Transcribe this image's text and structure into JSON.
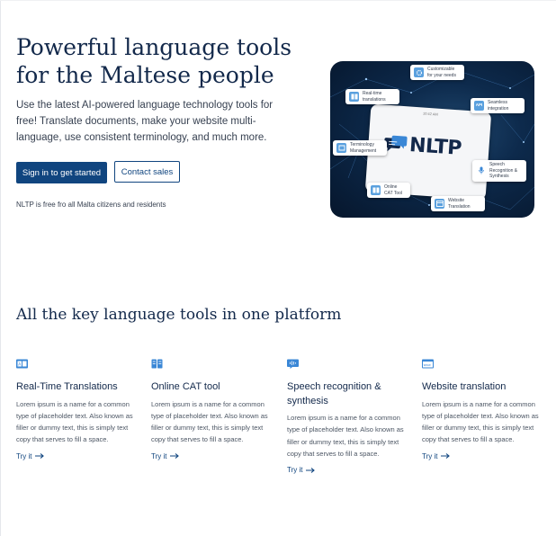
{
  "hero": {
    "title": "Powerful language tools for the Maltese people",
    "description": "Use the latest AI-powered language technology tools for free! Translate documents, make your website multi-language, use consistent terminology, and much more.",
    "primary_button": "Sign in to get started",
    "secondary_button": "Contact sales",
    "note": "NLTP is free fro all Malta citizens and residents"
  },
  "illustration": {
    "logo_text": "NLTP",
    "card_caption": "10:42 AM",
    "chips": {
      "customizable": "Customizable for your needs",
      "realtime": "Real-time translations",
      "seamless": "Seamless integration",
      "terminology": "Terminology Management",
      "speech": "Speech Recognition & Synthesis",
      "online_cat": "Online CAT Tool",
      "website": "Website Translation"
    },
    "api_label": "API"
  },
  "features_section": {
    "title": "All the key language tools in one platform",
    "items": [
      {
        "icon": "translate-icon",
        "title": "Real-Time Translations",
        "description": "Lorem ipsum is a name for a common type of placeholder text. Also known as filler or dummy text, this is simply text copy that serves to fill a space.",
        "link": "Try it"
      },
      {
        "icon": "cat-tool-icon",
        "title": "Online CAT tool",
        "description": "Lorem ipsum is a name for a common type of placeholder text. Also known as filler or dummy text, this is simply text copy that serves to fill a space.",
        "link": "Try it"
      },
      {
        "icon": "speech-icon",
        "title": "Speech recognition & synthesis",
        "description": "Lorem ipsum is a name for a common type of placeholder text. Also known as filler or dummy text, this is simply text copy that serves to fill a space.",
        "link": "Try it"
      },
      {
        "icon": "website-icon",
        "title": "Website translation",
        "description": "Lorem ipsum is a name for a common type of placeholder text. Also known as filler or dummy text, this is simply text copy that serves to fill a space.",
        "link": "Try it"
      }
    ]
  },
  "colors": {
    "brand_navy": "#13294b",
    "primary_button": "#10457f",
    "icon_blue": "#3a87d6"
  }
}
